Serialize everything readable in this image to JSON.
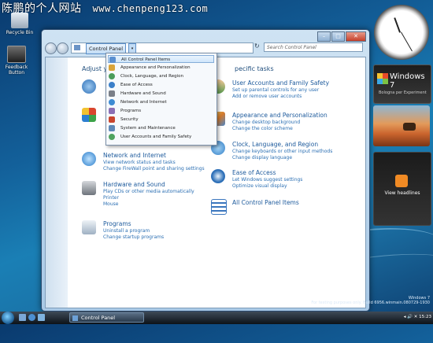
{
  "watermark": {
    "site": "陈鹏的个人网站",
    "url": "www.chenpeng123.com"
  },
  "desktop": {
    "icons": [
      {
        "label": "Recycle Bin"
      },
      {
        "label": "Feedback Button"
      }
    ]
  },
  "window": {
    "controls": {
      "minimize": "–",
      "maximize": "□",
      "close": "✕"
    },
    "address": {
      "crumb": "Control Panel",
      "dropdown": "▾",
      "refresh": "↻"
    },
    "search_placeholder": "Search Control Panel",
    "left_heading": "Adjust yo",
    "right_heading": "pecific tasks",
    "categories_left": [
      {
        "title": "Network and Internet",
        "links": [
          "View network status and tasks",
          "Change FireWall point and sharing settings"
        ]
      },
      {
        "title": "Hardware and Sound",
        "links": [
          "Play CDs or other media automatically",
          "Printer",
          "Mouse"
        ]
      },
      {
        "title": "Programs",
        "links": [
          "Uninstall a program",
          "Change startup programs"
        ]
      }
    ],
    "categories_right": [
      {
        "title": "User Accounts and Family Safety",
        "links": [
          "Set up parental controls for any user",
          "Add or remove user accounts"
        ]
      },
      {
        "title": "Appearance and Personalization",
        "links": [
          "Change desktop background",
          "Change the color scheme"
        ]
      },
      {
        "title": "Clock, Language, and Region",
        "links": [
          "Change keyboards or other input methods",
          "Change display language"
        ]
      },
      {
        "title": "Ease of Access",
        "links": [
          "Let Windows suggest settings",
          "Optimize visual display"
        ]
      },
      {
        "title": "All Control Panel Items",
        "links": []
      }
    ]
  },
  "dropdown": {
    "items": [
      {
        "label": "All Control Panel Items",
        "color": "#5a8fd0"
      },
      {
        "label": "Appearance and Personalization",
        "color": "#d9a43a"
      },
      {
        "label": "Clock, Language, and Region",
        "color": "#4a9c5a"
      },
      {
        "label": "Ease of Access",
        "color": "#3a7fc9"
      },
      {
        "label": "Hardware and Sound",
        "color": "#7a7f88"
      },
      {
        "label": "Network and Internet",
        "color": "#3d8bd3"
      },
      {
        "label": "Programs",
        "color": "#8a6fb5"
      },
      {
        "label": "Security",
        "color": "#c9452e"
      },
      {
        "label": "System and Maintenance",
        "color": "#5e88b8"
      },
      {
        "label": "User Accounts and Family Safety",
        "color": "#4fa35f"
      }
    ]
  },
  "gadgets": {
    "windows7": {
      "title": "Windows 7",
      "subtitle": "Bologna per Experiment"
    },
    "feed_label": "View headlines"
  },
  "winver": {
    "line1": "Windows 7",
    "line2": "For testing purposes only. Build 6956.winmain.080729-1930"
  },
  "taskbar": {
    "task": "Control Panel",
    "tray": "◂ 🔊 ✕ 15:23"
  }
}
